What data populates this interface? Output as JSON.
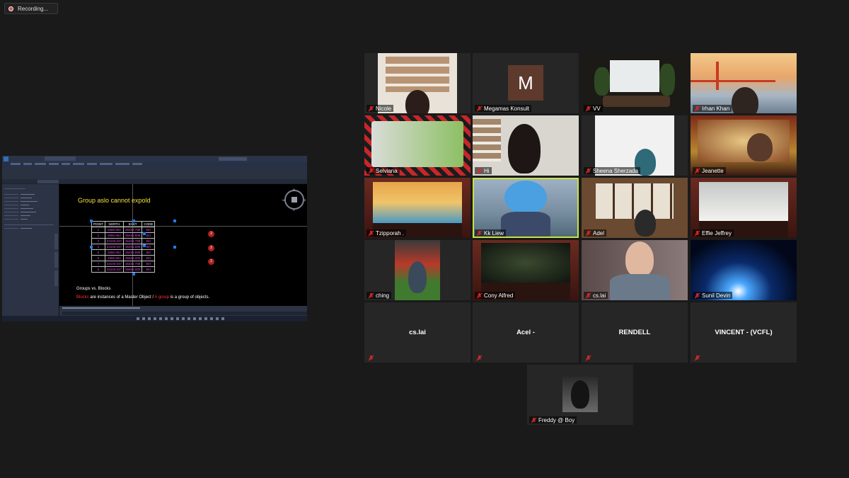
{
  "recording": {
    "label": "Recording..."
  },
  "share": {
    "heading": "Group aslo cannot expold",
    "subtitle": "Groups vs. Blocks",
    "caption_blocks": "Blocks",
    "caption_mid": " are instances of a Master Object  /  ",
    "caption_group": "A group",
    "caption_end": " is a group of objects.",
    "table": {
      "headers": [
        "POINT",
        "NORTH",
        "EAST",
        "CODE"
      ],
      "rows": [
        [
          "1",
          "2886.964",
          "36454.788",
          "BH"
        ],
        [
          "2",
          "2886.964",
          "36455.888",
          "BH"
        ],
        [
          "3",
          "23100.047",
          "36454.788",
          "BH"
        ],
        [
          "4",
          "23100.047",
          "36455.888",
          "BH"
        ],
        [
          "5",
          "2886.964",
          "36455.888",
          "BH"
        ],
        [
          "6",
          "2886.964",
          "36665.000",
          "BH"
        ],
        [
          "7",
          "23100.047",
          "36454.788",
          "BH"
        ],
        [
          "8",
          "23100.047",
          "36665.000",
          "BH"
        ]
      ]
    },
    "markers": [
      "2",
      "2",
      "2"
    ],
    "compass": {
      "n": "N",
      "s": "S",
      "w": "W",
      "e": "E"
    }
  },
  "participants": [
    {
      "name": "Nicole"
    },
    {
      "name": "Megamas Konsult",
      "initial": "M"
    },
    {
      "name": "VV"
    },
    {
      "name": "Irhan Khan"
    },
    {
      "name": "Selviana"
    },
    {
      "name": "Hi"
    },
    {
      "name": "Sheena Sherzada"
    },
    {
      "name": "Jeanette"
    },
    {
      "name": "Tzipporah ."
    },
    {
      "name": "Kk Liew"
    },
    {
      "name": "Adel"
    },
    {
      "name": "Effie Jeffrey"
    },
    {
      "name": "ching"
    },
    {
      "name": "Cony Alfred"
    },
    {
      "name": "cs.lai"
    },
    {
      "name": "Sunil Devin"
    },
    {
      "name": "cs.lai"
    },
    {
      "name": "Acel -"
    },
    {
      "name": "RENDELL"
    },
    {
      "name": "VINCENT - (VCFL)"
    },
    {
      "name": "Freddy @ Boy"
    }
  ],
  "colors": {
    "muted_mic": "#e02828",
    "active_speaker": "#c9e23f",
    "background": "#1a1a1a"
  },
  "icons": {
    "mic": "mic-muted-icon"
  }
}
